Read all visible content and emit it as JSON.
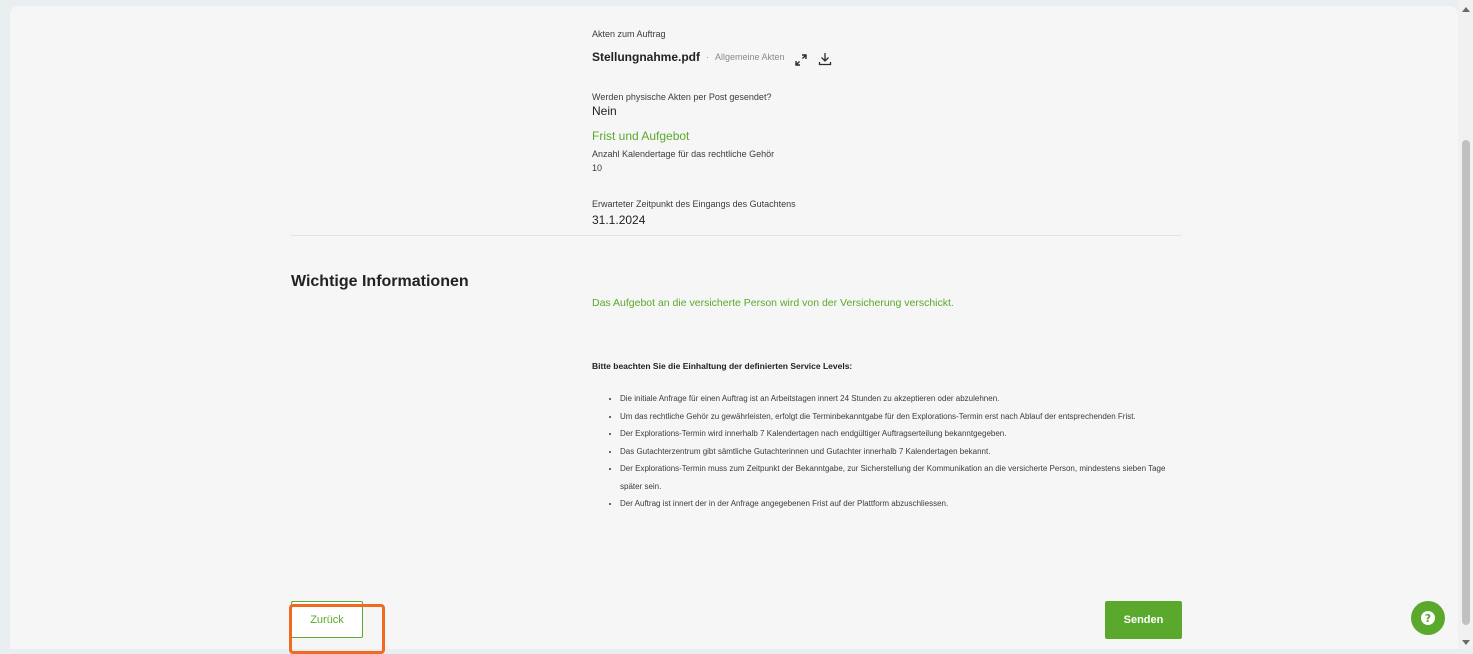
{
  "files": {
    "section_label": "Akten zum Auftrag",
    "file_name": "Stellungnahme.pdf",
    "separator": "·",
    "category": "Allgemeine Akten"
  },
  "physical": {
    "question": "Werden physische Akten per Post gesendet?",
    "answer": "Nein"
  },
  "deadline": {
    "title": "Frist und Aufgebot",
    "days_label": "Anzahl Kalendertage für das rechtliche Gehör",
    "days_value": "10",
    "expected_label": "Erwarteter Zeitpunkt des Eingangs des Gutachtens",
    "expected_value": "31.1.2024"
  },
  "important": {
    "title": "Wichtige Informationen",
    "notice": "Das Aufgebot an die versicherte Person wird von der Versicherung verschickt.",
    "service_heading": "Bitte beachten Sie die Einhaltung der definierten Service Levels:",
    "items": [
      "Die initiale Anfrage für einen Auftrag ist an Arbeitstagen innert 24 Stunden zu akzeptieren oder abzulehnen.",
      "Um das rechtliche Gehör zu gewährleisten, erfolgt die Terminbekanntgabe für den Explorations-Termin erst nach Ablauf der entsprechenden Frist.",
      "Der Explorations-Termin wird innerhalb 7 Kalendertagen nach endgültiger Auftragserteilung bekanntgegeben.",
      "Das Gutachterzentrum gibt sämtliche Gutachterinnen und Gutachter innerhalb 7 Kalendertagen bekannt.",
      "Der Explorations-Termin muss zum Zeitpunkt der Bekanntgabe, zur Sicherstellung der Kommunikation an die versicherte Person, mindestens sieben Tage später sein.",
      "Der Auftrag ist innert der in der Anfrage angegebenen Frist auf der Plattform abzuschliessen."
    ]
  },
  "actions": {
    "back_label": "Zurück",
    "send_label": "Senden"
  },
  "help": {
    "glyph": "?"
  },
  "colors": {
    "accent": "#5aa92c",
    "highlight": "#f26a1f"
  }
}
